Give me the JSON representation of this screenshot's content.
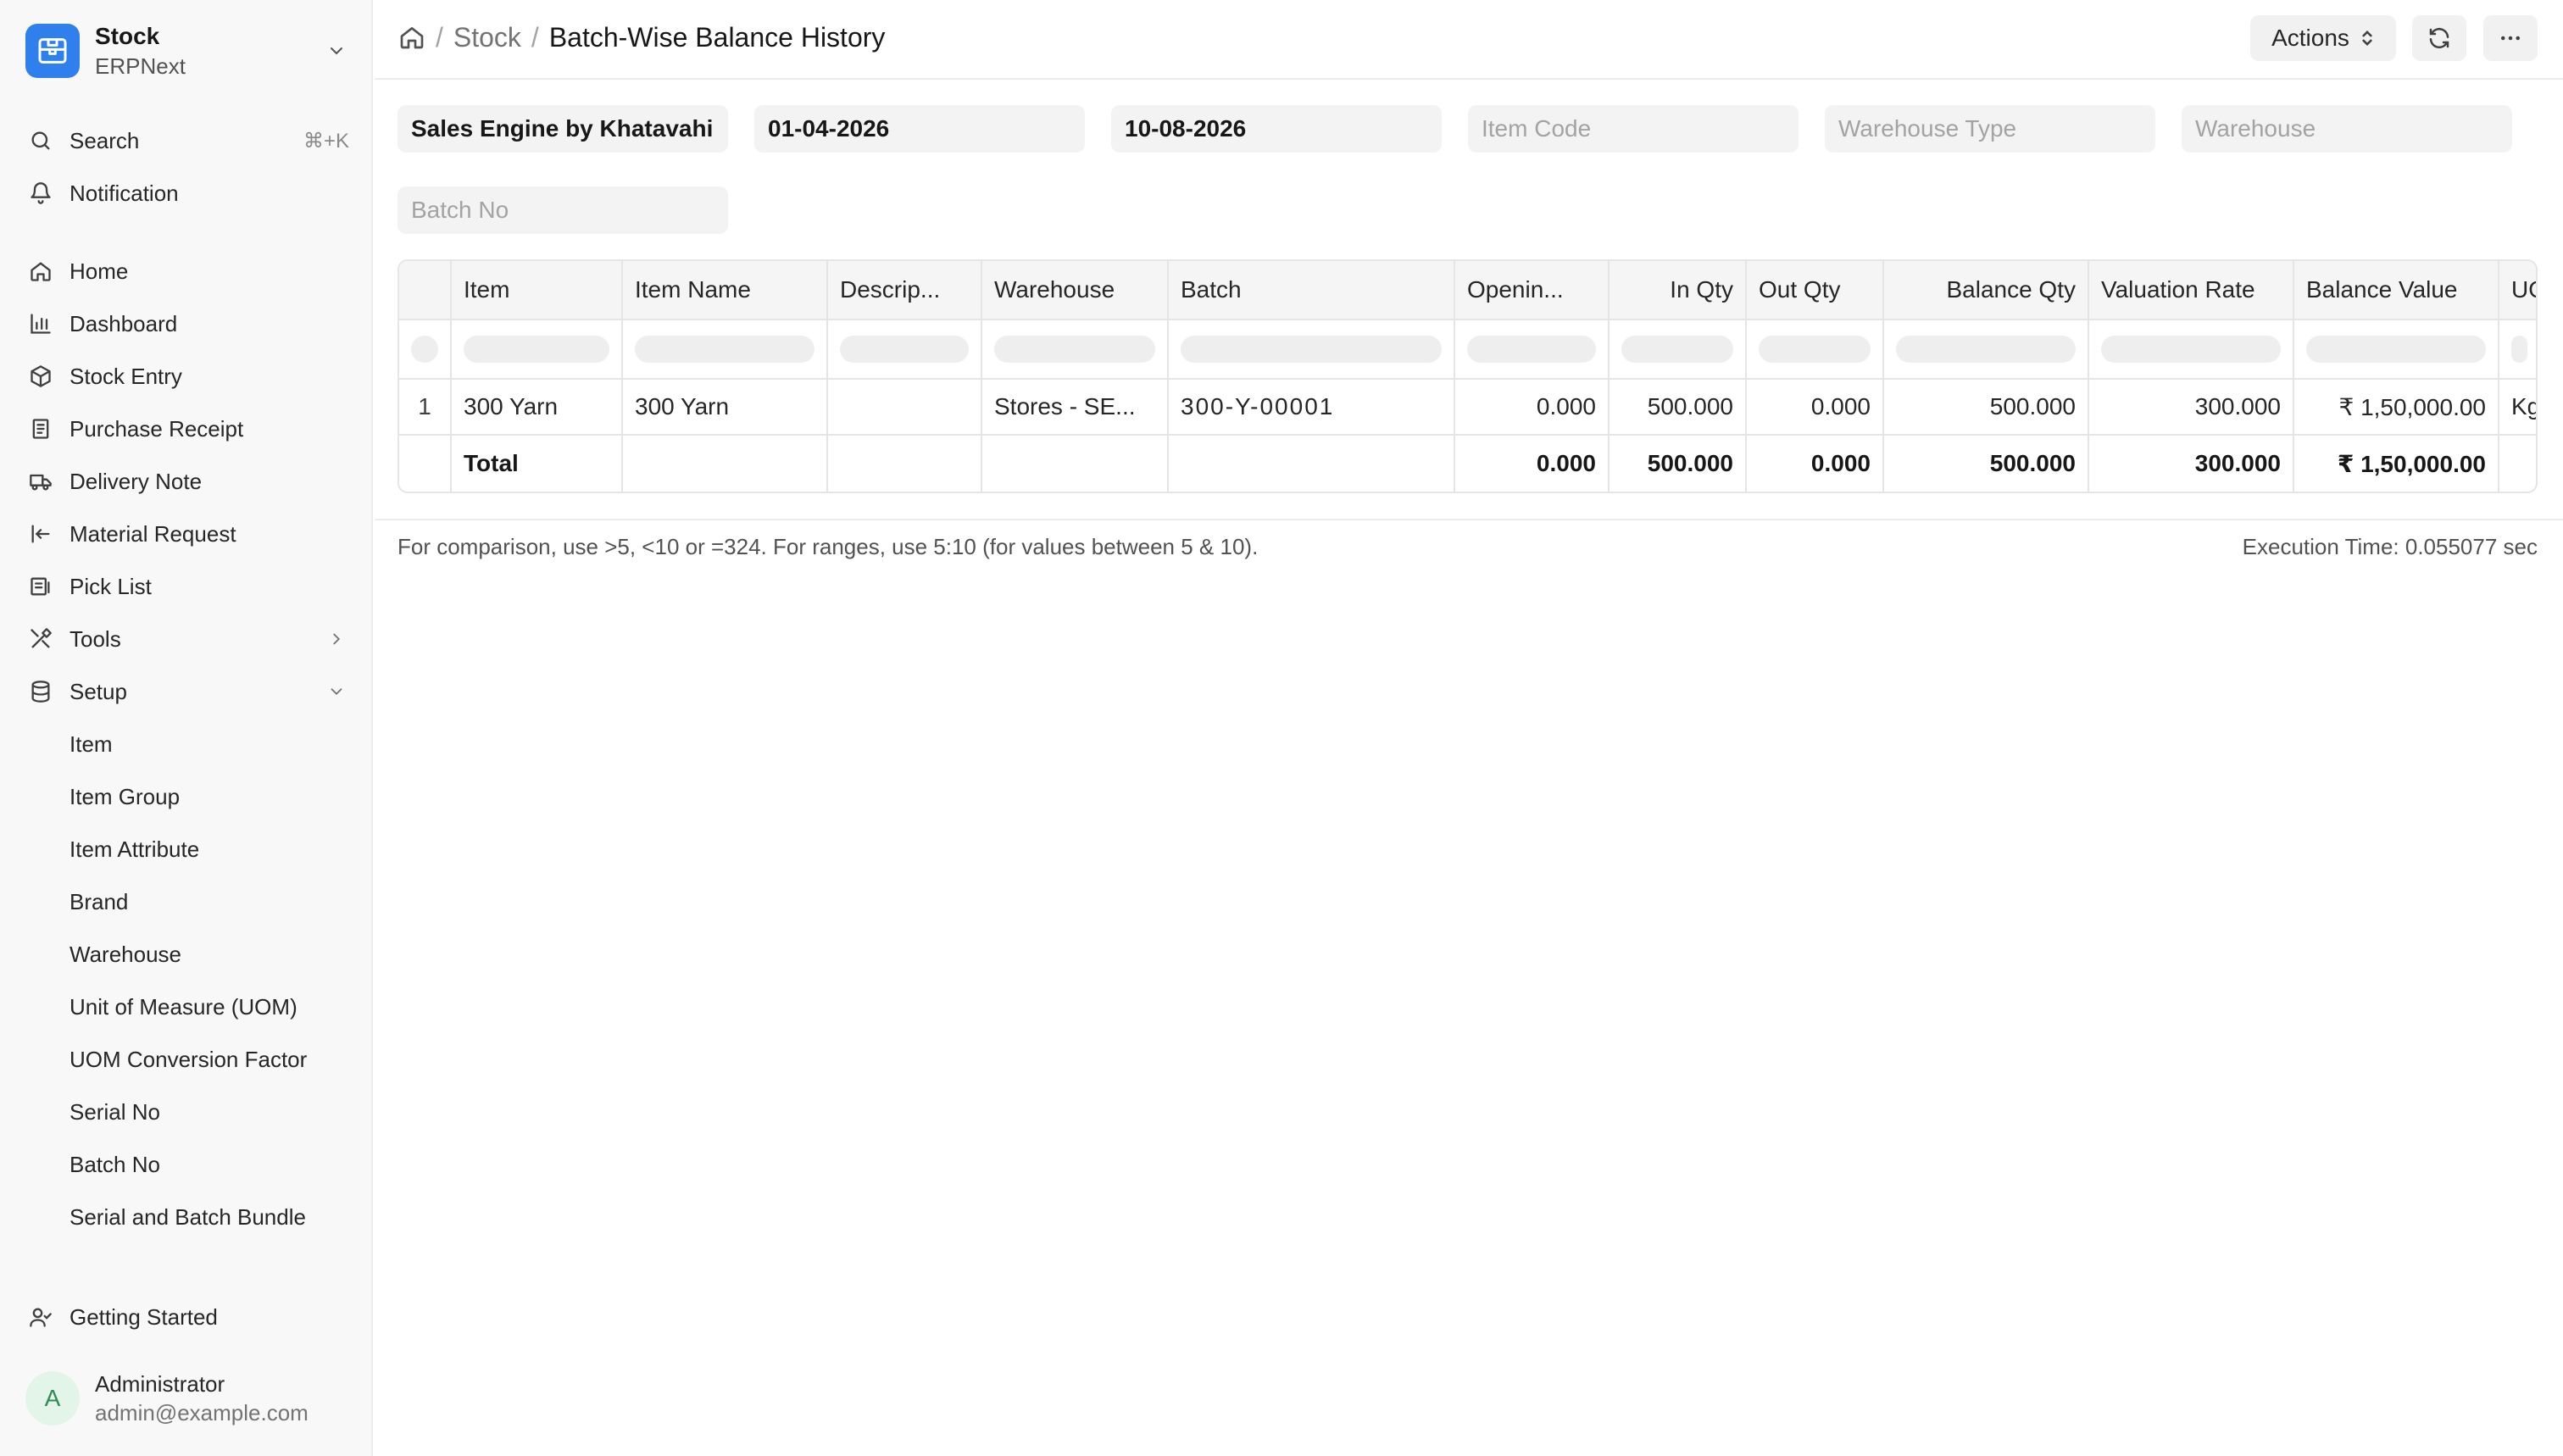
{
  "app": {
    "title": "Stock",
    "subtitle": "ERPNext",
    "accent": "#2f80ed"
  },
  "sidebar": {
    "search_label": "Search",
    "search_shortcut": "⌘+K",
    "notification_label": "Notification",
    "items": [
      {
        "label": "Home",
        "icon": "home-icon"
      },
      {
        "label": "Dashboard",
        "icon": "bar-chart-icon"
      },
      {
        "label": "Stock Entry",
        "icon": "box-icon"
      },
      {
        "label": "Purchase Receipt",
        "icon": "receipt-icon"
      },
      {
        "label": "Delivery Note",
        "icon": "truck-icon"
      },
      {
        "label": "Material Request",
        "icon": "arrow-left-to-line-icon"
      },
      {
        "label": "Pick List",
        "icon": "list-icon"
      },
      {
        "label": "Tools",
        "icon": "tools-icon"
      },
      {
        "label": "Setup",
        "icon": "database-icon"
      }
    ],
    "setup_children": [
      "Item",
      "Item Group",
      "Item Attribute",
      "Brand",
      "Warehouse",
      "Unit of Measure (UOM)",
      "UOM Conversion Factor",
      "Serial No",
      "Batch No",
      "Serial and Batch Bundle"
    ],
    "getting_started_label": "Getting Started",
    "user": {
      "initial": "A",
      "name": "Administrator",
      "email": "admin@example.com"
    }
  },
  "header": {
    "breadcrumb_module": "Stock",
    "breadcrumb_sep": "/",
    "page_title": "Batch-Wise Balance History",
    "actions_label": "Actions"
  },
  "filters": {
    "company": "Sales Engine by Khatavahi",
    "from_date": "01-04-2026",
    "to_date": "10-08-2026",
    "item_code_placeholder": "Item Code",
    "warehouse_type_placeholder": "Warehouse Type",
    "warehouse_placeholder": "Warehouse",
    "batch_no_placeholder": "Batch No"
  },
  "table": {
    "columns": [
      "Item",
      "Item Name",
      "Descrip...",
      "Warehouse",
      "Batch",
      "Openin...",
      "In Qty",
      "Out Qty",
      "Balance Qty",
      "Valuation Rate",
      "Balance Value",
      "UO"
    ],
    "rows": [
      {
        "index": "1",
        "cells": [
          "300 Yarn",
          "300 Yarn",
          "",
          "Stores - SE...",
          "300-Y-00001",
          "0.000",
          "500.000",
          "0.000",
          "500.000",
          "300.000",
          "₹ 1,50,000.00",
          "Kg"
        ]
      }
    ],
    "total": {
      "label": "Total",
      "cells": [
        "",
        "",
        "",
        "",
        "0.000",
        "500.000",
        "0.000",
        "500.000",
        "300.000",
        "₹ 1,50,000.00",
        ""
      ]
    }
  },
  "footer": {
    "note": "For comparison, use >5, <10 or =324. For ranges, use 5:10 (for values between 5 & 10).",
    "execution_time": "Execution Time: 0.055077 sec"
  }
}
